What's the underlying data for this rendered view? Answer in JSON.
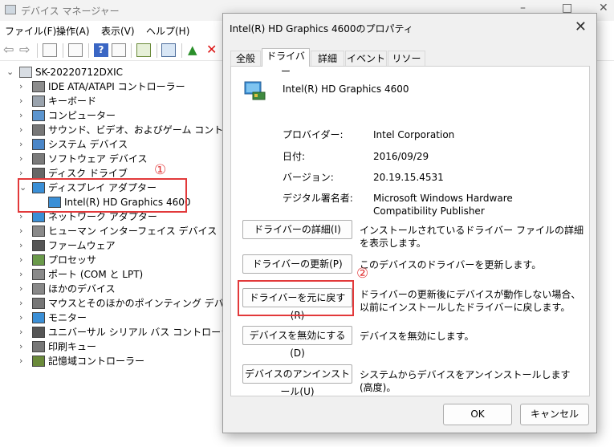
{
  "device_manager": {
    "title": "デバイス マネージャー",
    "window_controls": [
      "–",
      "□",
      "✕"
    ],
    "menu": [
      "ファイル(F)",
      "操作(A)",
      "表示(V)",
      "ヘルプ(H)"
    ],
    "tree": {
      "root": "SK-20220712DXIC",
      "items": [
        {
          "label": "IDE ATA/ATAPI コントローラー",
          "icon": "ide-controller-icon"
        },
        {
          "label": "キーボード",
          "icon": "keyboard-icon"
        },
        {
          "label": "コンピューター",
          "icon": "computer-icon"
        },
        {
          "label": "サウンド、ビデオ、およびゲーム コントローラー",
          "icon": "speaker-icon"
        },
        {
          "label": "システム デバイス",
          "icon": "system-device-icon"
        },
        {
          "label": "ソフトウェア デバイス",
          "icon": "software-device-icon"
        },
        {
          "label": "ディスク ドライブ",
          "icon": "disk-drive-icon"
        },
        {
          "label": "ディスプレイ アダプター",
          "icon": "display-adapter-icon"
        },
        {
          "label": "Intel(R) HD Graphics 4600",
          "icon": "display-adapter-icon"
        },
        {
          "label": "ネットワーク アダプター",
          "icon": "network-adapter-icon"
        },
        {
          "label": "ヒューマン インターフェイス デバイス",
          "icon": "hid-icon"
        },
        {
          "label": "ファームウェア",
          "icon": "firmware-icon"
        },
        {
          "label": "プロセッサ",
          "icon": "processor-icon"
        },
        {
          "label": "ポート (COM と LPT)",
          "icon": "port-icon"
        },
        {
          "label": "ほかのデバイス",
          "icon": "other-device-icon"
        },
        {
          "label": "マウスとそのほかのポインティング デバイス",
          "icon": "mouse-icon"
        },
        {
          "label": "モニター",
          "icon": "monitor-icon"
        },
        {
          "label": "ユニバーサル シリアル バス コントローラー",
          "icon": "usb-icon"
        },
        {
          "label": "印刷キュー",
          "icon": "printer-icon"
        },
        {
          "label": "記憶域コントローラー",
          "icon": "storage-controller-icon"
        }
      ]
    },
    "annotation_1": "①"
  },
  "dialog": {
    "title": "Intel(R) HD Graphics 4600のプロパティ",
    "close": "✕",
    "tabs": [
      "全般",
      "ドライバー",
      "詳細",
      "イベント",
      "リソース"
    ],
    "device_name": "Intel(R) HD Graphics 4600",
    "props": [
      {
        "key": "プロバイダー:",
        "value": "Intel Corporation"
      },
      {
        "key": "日付:",
        "value": "2016/09/29"
      },
      {
        "key": "バージョン:",
        "value": "20.19.15.4531"
      },
      {
        "key": "デジタル署名者:",
        "value": "Microsoft Windows Hardware Compatibility Publisher"
      }
    ],
    "actions": [
      {
        "button": "ドライバーの詳細(I)",
        "desc": "インストールされているドライバー ファイルの詳細を表示します。"
      },
      {
        "button": "ドライバーの更新(P)",
        "desc": "このデバイスのドライバーを更新します。"
      },
      {
        "button": "ドライバーを元に戻す(R)",
        "desc": "ドライバーの更新後にデバイスが動作しない場合、以前にインストールしたドライバーに戻します。"
      },
      {
        "button": "デバイスを無効にする(D)",
        "desc": "デバイスを無効にします。"
      },
      {
        "button": "デバイスのアンインストール(U)",
        "desc": "システムからデバイスをアンインストールします (高度)。"
      }
    ],
    "ok": "OK",
    "cancel": "キャンセル",
    "annotation_2": "②"
  },
  "colors": {
    "highlight_red": "#e2393a"
  }
}
